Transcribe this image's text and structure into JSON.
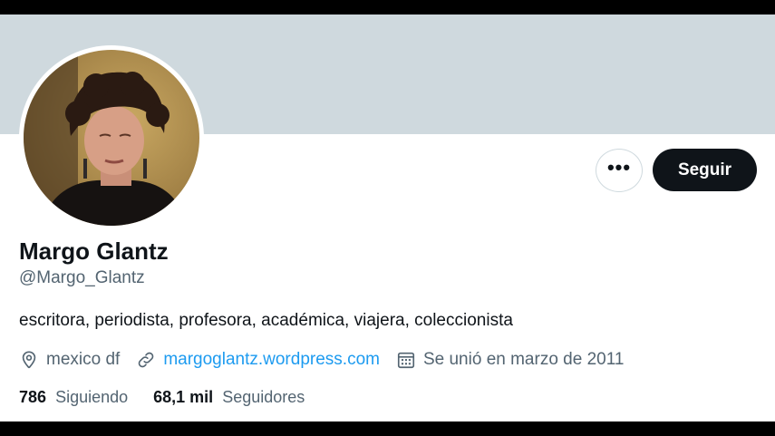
{
  "colors": {
    "banner": "#cfd9de",
    "primary_text": "#0f1419",
    "secondary_text": "#536471",
    "link": "#1d9bf0",
    "follow_button_bg": "#0f1419",
    "follow_button_text": "#ffffff"
  },
  "profile": {
    "name": "Margo Glantz",
    "handle": "@Margo_Glantz",
    "bio": "escritora, periodista, profesora, académica, viajera, coleccionista",
    "avatar_icon": "profile-photo"
  },
  "actions": {
    "more_label": "•••",
    "more_icon": "more-options-icon",
    "follow_label": "Seguir"
  },
  "meta": {
    "location_icon": "location-pin-icon",
    "location": "mexico df",
    "link_icon": "link-icon",
    "website": "margoglantz.wordpress.com",
    "calendar_icon": "calendar-icon",
    "joined": "Se unió en marzo de 2011"
  },
  "stats": {
    "following_count": "786",
    "following_label": "Siguiendo",
    "followers_count": "68,1 mil",
    "followers_label": "Seguidores"
  }
}
